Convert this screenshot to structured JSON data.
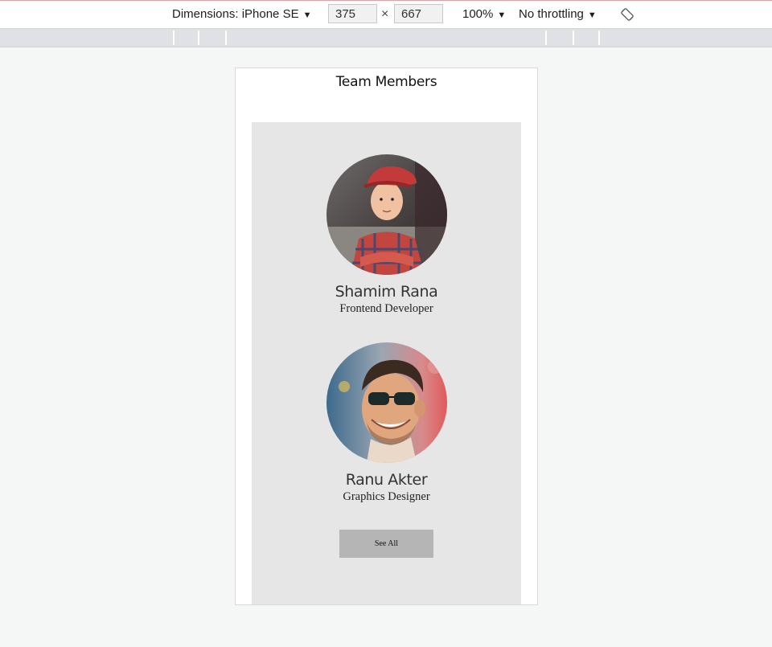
{
  "devtools": {
    "dimensions_label": "Dimensions: iPhone SE",
    "width_value": "375",
    "height_value": "667",
    "times_sign": "×",
    "zoom_label": "100%",
    "throttle_label": "No throttling",
    "caret": "▼",
    "rotate_icon": "rotate-icon"
  },
  "page": {
    "title": "Team Members",
    "members": [
      {
        "name": "Shamim Rana",
        "role": "Frontend Developer",
        "avatar_icon": "boy-photo"
      },
      {
        "name": "Ranu Akter",
        "role": "Graphics Designer",
        "avatar_icon": "man-sunglasses-photo"
      }
    ],
    "see_all_label": "See All"
  },
  "colors": {
    "page_bg": "#f5f7f7",
    "panel_bg": "#e6e6e6",
    "button_bg": "#b5b5b5"
  }
}
